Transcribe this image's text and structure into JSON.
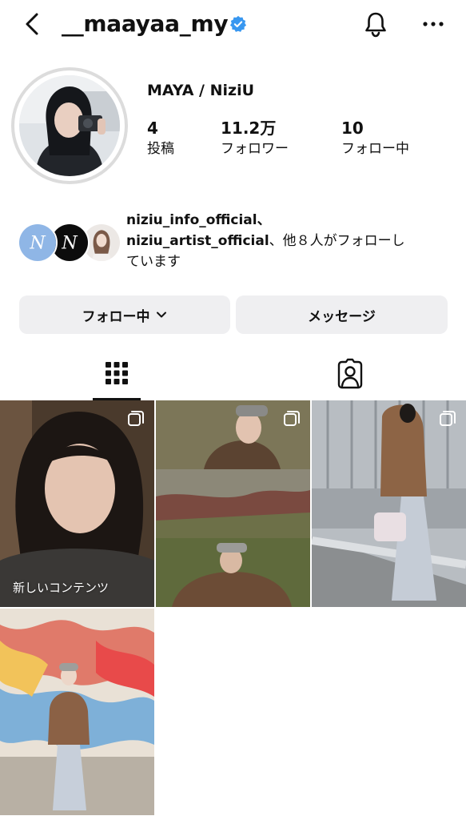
{
  "header": {
    "username": "__maayaa_my",
    "verified": true,
    "icons": [
      "back-chevron-icon",
      "verified-badge-icon",
      "bell-icon",
      "more-icon"
    ]
  },
  "profile": {
    "display_name": "MAYA / NiziU",
    "stats": [
      {
        "value": "4",
        "label": "投稿"
      },
      {
        "value": "11.2万",
        "label": "フォロワー"
      },
      {
        "value": "10",
        "label": "フォロー中"
      }
    ]
  },
  "followed_by": {
    "line1": "niziu_info_official、",
    "line2_bold": "niziu_artist_official",
    "line2_rest": "、他８人がフォローし",
    "line3": "ています"
  },
  "buttons": {
    "follow_label": "フォロー中",
    "message_label": "メッセージ"
  },
  "tabs": [
    {
      "name": "posts-grid",
      "icon": "grid-icon",
      "active": true
    },
    {
      "name": "tagged",
      "icon": "tagged-person-icon",
      "active": false
    }
  ],
  "posts": [
    {
      "label": "新しいコンテンツ",
      "multi": true
    },
    {
      "label": "",
      "multi": true
    },
    {
      "label": "",
      "multi": true
    },
    {
      "label": "",
      "multi": false
    }
  ],
  "colors": {
    "verified": "#3897f0",
    "button_bg": "#efeff1",
    "text": "#111111"
  }
}
